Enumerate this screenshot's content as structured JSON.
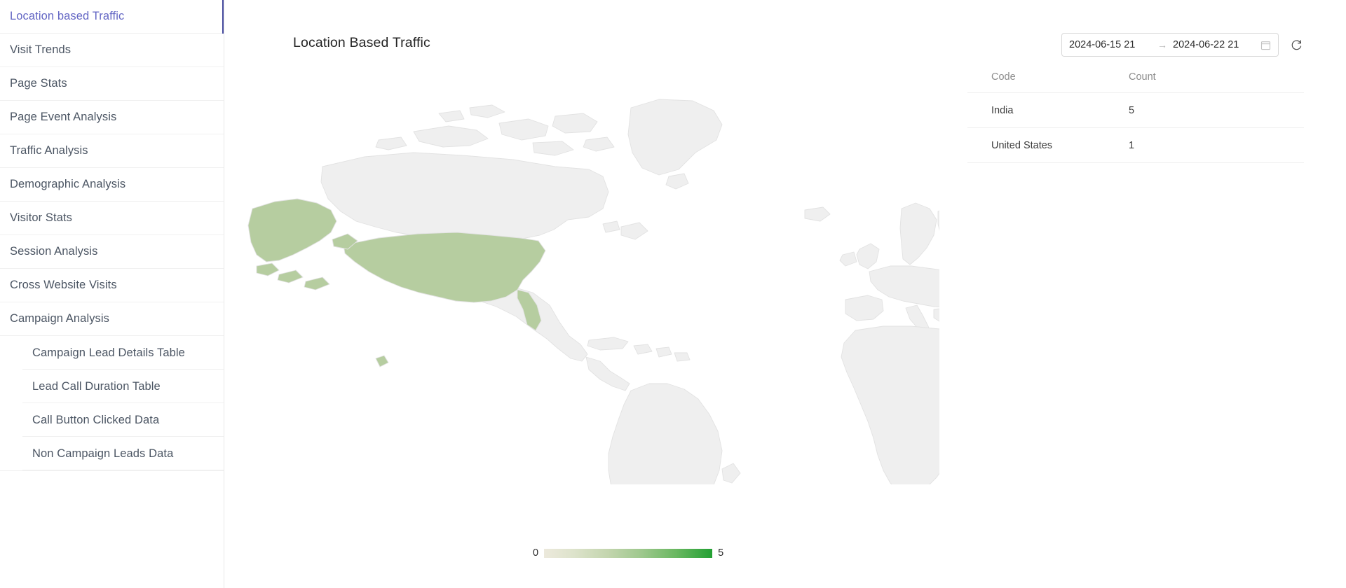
{
  "accent": {
    "active_text": "#6366c4",
    "active_bar": "#464a9e",
    "map_high": "#23a033",
    "map_mid": "#b6cda0",
    "map_base": "#efefef"
  },
  "sidebar": {
    "items": [
      {
        "label": "Location based Traffic",
        "active": true
      },
      {
        "label": "Visit Trends",
        "active": false
      },
      {
        "label": "Page Stats",
        "active": false
      },
      {
        "label": "Page Event Analysis",
        "active": false
      },
      {
        "label": "Traffic Analysis",
        "active": false
      },
      {
        "label": "Demographic Analysis",
        "active": false
      },
      {
        "label": "Visitor Stats",
        "active": false
      },
      {
        "label": "Session Analysis",
        "active": false
      },
      {
        "label": "Cross Website Visits",
        "active": false
      },
      {
        "label": "Campaign Analysis",
        "active": false
      }
    ],
    "sub_items": [
      {
        "label": "Campaign Lead Details Table"
      },
      {
        "label": "Lead Call Duration Table"
      },
      {
        "label": "Call Button Clicked Data"
      },
      {
        "label": "Non Campaign Leads Data"
      }
    ]
  },
  "main": {
    "title": "Location Based Traffic"
  },
  "toolbar": {
    "date_start": "2024-06-15 21",
    "date_end": "2024-06-22 21",
    "range_separator": "→",
    "calendar_icon": "calendar-icon",
    "refresh_icon": "refresh-icon"
  },
  "table": {
    "columns": [
      "Code",
      "Count"
    ],
    "rows": [
      {
        "code": "India",
        "count": "5"
      },
      {
        "code": "United States",
        "count": "1"
      }
    ]
  },
  "chart_data": {
    "type": "choropleth",
    "title": "Location Based Traffic",
    "metric": "Count",
    "legend": {
      "min": "0",
      "max": "5",
      "position": "bottom-left",
      "gradient": [
        "#ece9dc",
        "#23a033"
      ]
    },
    "categories": [
      "India",
      "United States"
    ],
    "values": [
      5,
      1
    ],
    "series": [
      {
        "name": "Count",
        "values": [
          5,
          1
        ]
      }
    ],
    "region_colors": {
      "India": "#23a033",
      "United States": "#b6cda0",
      "default": "#efefef"
    },
    "vmin": 0,
    "vmax": 5
  }
}
